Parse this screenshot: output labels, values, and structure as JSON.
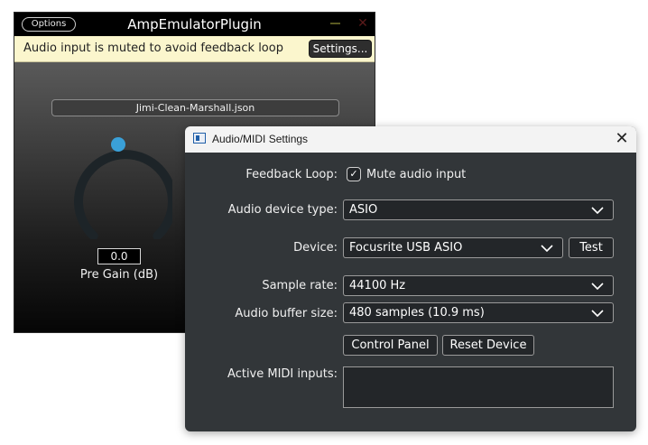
{
  "plugin": {
    "options_label": "Options",
    "title": "AmpEmulatorPlugin",
    "notice": {
      "text": "Audio input is muted to avoid feedback loop",
      "settings_label": "Settings..."
    },
    "preset_name": "Jimi-Clean-Marshall.json",
    "pre_gain": {
      "value": "0.0",
      "label": "Pre Gain (dB)",
      "knob_position": 0.5
    }
  },
  "dialog": {
    "title": "Audio/MIDI Settings",
    "feedback_loop": {
      "label": "Feedback Loop:",
      "checkbox_label": "Mute audio input",
      "checked": true
    },
    "device_type": {
      "label": "Audio device type:",
      "value": "ASIO"
    },
    "device": {
      "label": "Device:",
      "value": "Focusrite USB ASIO",
      "test_label": "Test"
    },
    "sample_rate": {
      "label": "Sample rate:",
      "value": "44100 Hz"
    },
    "buffer_size": {
      "label": "Audio buffer size:",
      "value": "480 samples (10.9 ms)"
    },
    "control_panel_label": "Control Panel",
    "reset_device_label": "Reset Device",
    "midi_inputs": {
      "label": "Active MIDI inputs:",
      "items": []
    }
  },
  "colors": {
    "notice_background": "#fbf6cd",
    "knob_thumb": "#3aa0d8",
    "dialog_background": "#323639"
  }
}
